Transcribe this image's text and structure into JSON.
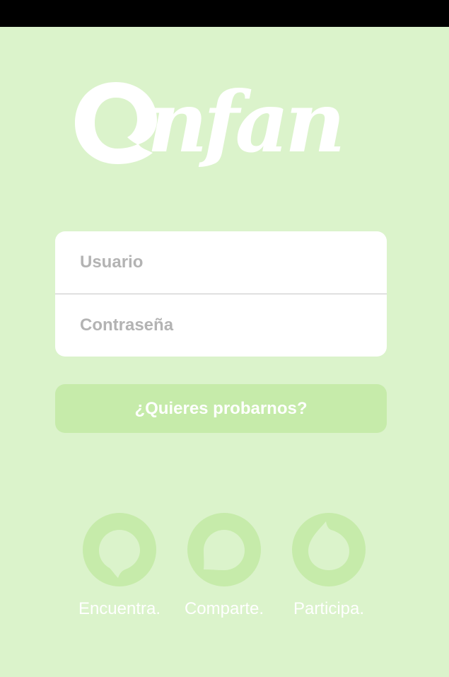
{
  "app": {
    "brand": "Onfan",
    "colors": {
      "background": "#dbf3cb",
      "accent": "#c6ebaa",
      "white": "#ffffff",
      "status_bar": "#000000"
    }
  },
  "login": {
    "username_placeholder": "Usuario",
    "password_placeholder": "Contraseña",
    "try_button_label": "¿Quieres probarnos?"
  },
  "features": [
    {
      "label": "Encuentra.",
      "icon": "speech-bubble-left-icon"
    },
    {
      "label": "Comparte.",
      "icon": "speech-bubble-bottom-left-icon"
    },
    {
      "label": "Participa.",
      "icon": "drop-icon"
    }
  ]
}
